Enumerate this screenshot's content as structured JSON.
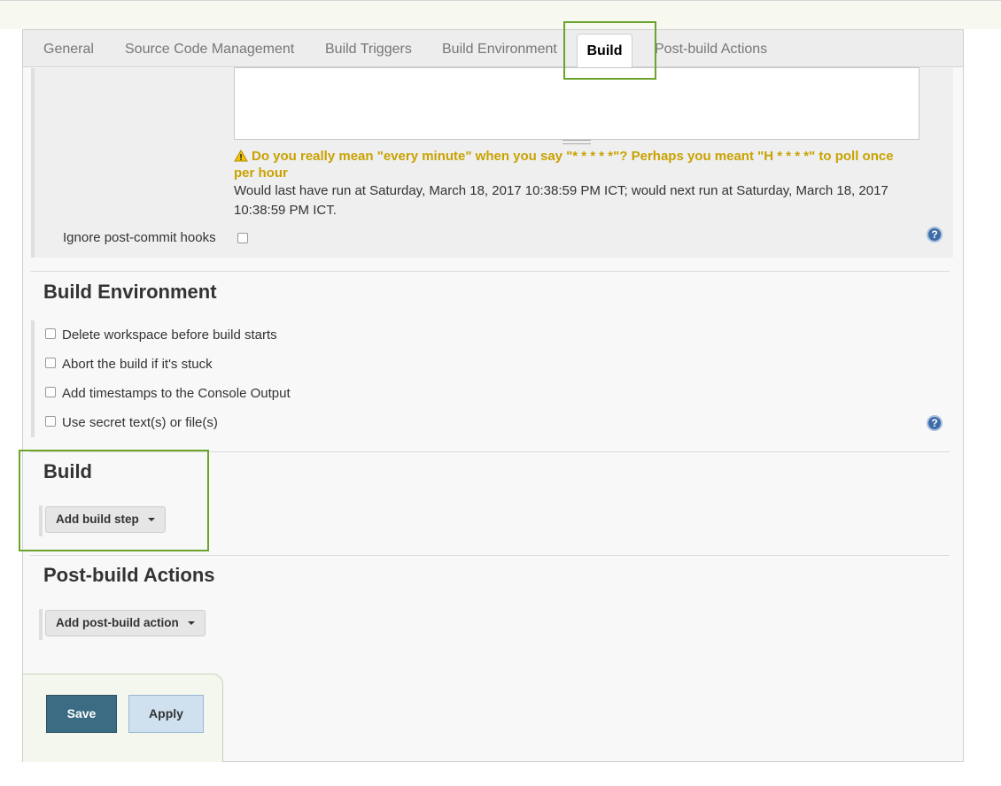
{
  "tabs": [
    "General",
    "Source Code Management",
    "Build Triggers",
    "Build Environment",
    "Build",
    "Post-build Actions"
  ],
  "active_tab": "Build",
  "scm": {
    "warning": "Do you really mean \"every minute\" when you say \"* * * * *\"? Perhaps you meant \"H * * * *\" to poll once per hour",
    "info": "Would last have run at Saturday, March 18, 2017 10:38:59 PM ICT; would next run at Saturday, March 18, 2017 10:38:59 PM ICT.",
    "ignore_hooks_label": "Ignore post-commit hooks"
  },
  "build_env": {
    "heading": "Build Environment",
    "options": [
      "Delete workspace before build starts",
      "Abort the build if it's stuck",
      "Add timestamps to the Console Output",
      "Use secret text(s) or file(s)"
    ]
  },
  "build": {
    "heading": "Build",
    "add_step_label": "Add build step"
  },
  "post_build": {
    "heading": "Post-build Actions",
    "add_action_label": "Add post-build action"
  },
  "buttons": {
    "save": "Save",
    "apply": "Apply"
  },
  "help_glyph": "?",
  "colors": {
    "highlight": "#6ba32b",
    "warning": "#c9a200",
    "save_bg": "#3b6c84",
    "apply_bg": "#cfe0ef",
    "help_icon": "#3e6ca8"
  },
  "icons": [
    "warning-icon",
    "help-icon",
    "caret-down-icon"
  ]
}
